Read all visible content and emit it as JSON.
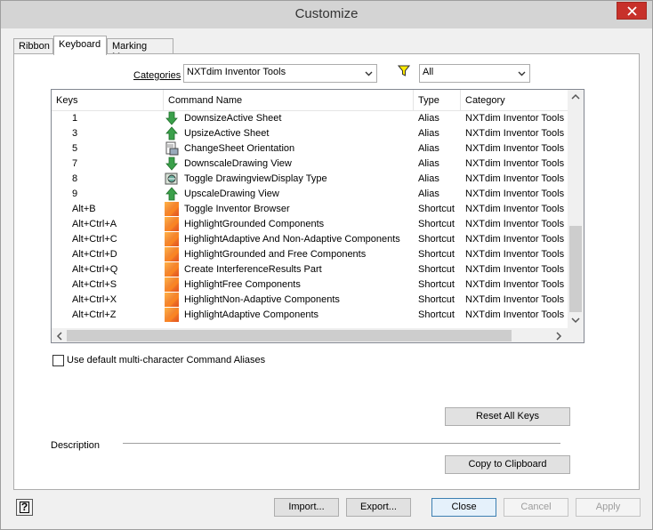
{
  "window": {
    "title": "Customize"
  },
  "tabs": [
    {
      "label": "Ribbon",
      "active": false
    },
    {
      "label": "Keyboard",
      "active": true
    },
    {
      "label": "Marking Menu",
      "active": false
    }
  ],
  "categories": {
    "label": "Categories",
    "selected": "NXTdim Inventor Tools",
    "filter_icon": "funnel-icon",
    "filter_selected": "All"
  },
  "grid": {
    "columns": [
      "Keys",
      "Command Name",
      "Type",
      "Category"
    ],
    "rows": [
      {
        "key": "1",
        "command": "DownsizeActive Sheet",
        "type": "Alias",
        "category": "NXTdim Inventor Tools",
        "icon": "arrow-down-icon"
      },
      {
        "key": "3",
        "command": "UpsizeActive Sheet",
        "type": "Alias",
        "category": "NXTdim Inventor Tools",
        "icon": "arrow-up-icon"
      },
      {
        "key": "5",
        "command": "ChangeSheet Orientation",
        "type": "Alias",
        "category": "NXTdim Inventor Tools",
        "icon": "sheet-orientation-icon"
      },
      {
        "key": "7",
        "command": "DownscaleDrawing View",
        "type": "Alias",
        "category": "NXTdim Inventor Tools",
        "icon": "arrow-down-icon"
      },
      {
        "key": "8",
        "command": "Toggle DrawingviewDisplay Type",
        "type": "Alias",
        "category": "NXTdim Inventor Tools",
        "icon": "drawing-view-display-icon"
      },
      {
        "key": "9",
        "command": "UpscaleDrawing View",
        "type": "Alias",
        "category": "NXTdim Inventor Tools",
        "icon": "arrow-up-icon"
      },
      {
        "key": "Alt+B",
        "command": "Toggle Inventor Browser",
        "type": "Shortcut",
        "category": "NXTdim Inventor Tools",
        "icon": "orange-command-icon"
      },
      {
        "key": "Alt+Ctrl+A",
        "command": "HighlightGrounded Components",
        "type": "Shortcut",
        "category": "NXTdim Inventor Tools",
        "icon": "orange-command-icon"
      },
      {
        "key": "Alt+Ctrl+C",
        "command": "HighlightAdaptive And Non-Adaptive Components",
        "type": "Shortcut",
        "category": "NXTdim Inventor Tools",
        "icon": "orange-command-icon"
      },
      {
        "key": "Alt+Ctrl+D",
        "command": "HighlightGrounded and Free Components",
        "type": "Shortcut",
        "category": "NXTdim Inventor Tools",
        "icon": "orange-command-icon"
      },
      {
        "key": "Alt+Ctrl+Q",
        "command": "Create InterferenceResults Part",
        "type": "Shortcut",
        "category": "NXTdim Inventor Tools",
        "icon": "orange-command-icon"
      },
      {
        "key": "Alt+Ctrl+S",
        "command": "HighlightFree Components",
        "type": "Shortcut",
        "category": "NXTdim Inventor Tools",
        "icon": "orange-command-icon"
      },
      {
        "key": "Alt+Ctrl+X",
        "command": "HighlightNon-Adaptive Components",
        "type": "Shortcut",
        "category": "NXTdim Inventor Tools",
        "icon": "orange-command-icon"
      },
      {
        "key": "Alt+Ctrl+Z",
        "command": "HighlightAdaptive Components",
        "type": "Shortcut",
        "category": "NXTdim Inventor Tools",
        "icon": "orange-command-icon"
      }
    ]
  },
  "options": {
    "default_aliases_label": "Use default multi-character Command Aliases",
    "default_aliases_checked": false
  },
  "buttons": {
    "reset_all_keys": "Reset All Keys",
    "copy_to_clipboard": "Copy to Clipboard",
    "import": "Import...",
    "export": "Export...",
    "close": "Close",
    "cancel": "Cancel",
    "apply": "Apply"
  },
  "description": {
    "label": "Description"
  },
  "colors": {
    "accent_border": "#3c7fb1",
    "close_red": "#c7312a",
    "alias_icon_green": "#3aa04a",
    "shortcut_icon_orange": "#f07a1a"
  }
}
